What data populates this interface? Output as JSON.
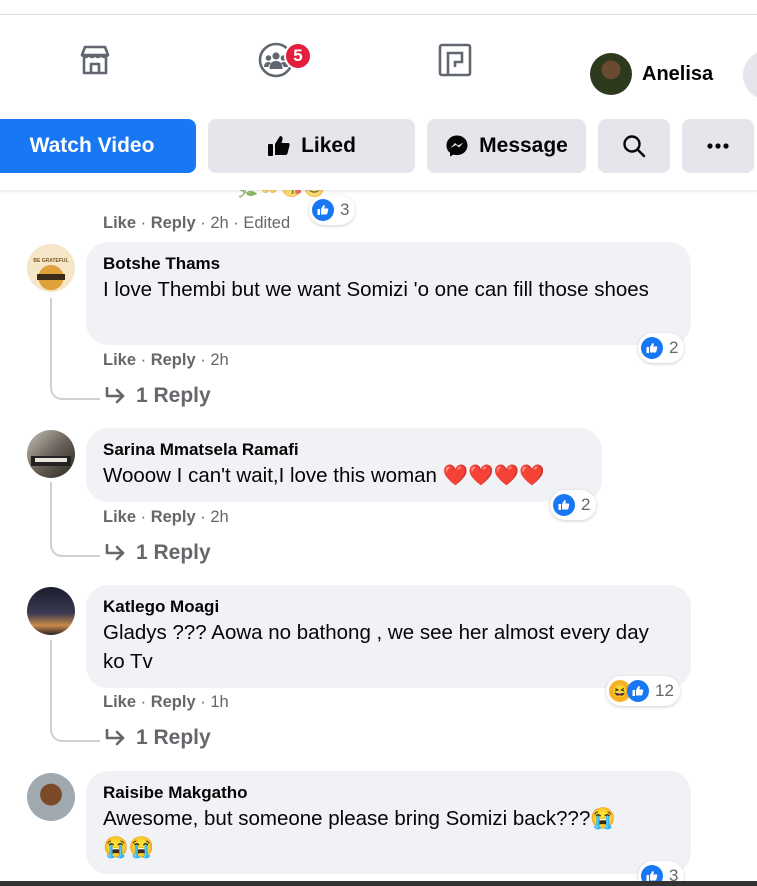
{
  "nav": {
    "icons": [
      "marketplace-icon",
      "groups-icon",
      "gaming-icon"
    ],
    "groups_badge": "5",
    "profile_name": "Anelisa"
  },
  "actions": {
    "watch": "Watch Video",
    "liked": "Liked",
    "message": "Message"
  },
  "partial_comment": {
    "like": "Like",
    "reply": "Reply",
    "time": "2h",
    "edited": "Edited",
    "reactions": "3"
  },
  "comments": [
    {
      "author": "Botshe Thams",
      "text": "I love Thembi but we want Somizi 'o one can fill those shoes",
      "like": "Like",
      "reply": "Reply",
      "time": "2h",
      "reactions": "2",
      "replies": "1 Reply"
    },
    {
      "author": "Sarina Mmatsela Ramafi",
      "text": "Wooow I can't wait,I love this woman",
      "hearts": "❤️❤️❤️❤️",
      "like": "Like",
      "reply": "Reply",
      "time": "2h",
      "reactions": "2",
      "replies": "1 Reply"
    },
    {
      "author": "Katlego Moagi",
      "text": "Gladys ??? Aowa no bathong , we see her almost every day ko Tv",
      "like": "Like",
      "reply": "Reply",
      "time": "1h",
      "reactions": "12",
      "replies": "1 Reply"
    },
    {
      "author": "Raisibe Makgatho",
      "text": "Awesome, but someone please bring Somizi back???",
      "emoji": "😭",
      "emoji_line2": "😭😭",
      "reactions": "3"
    }
  ],
  "colors": {
    "brand": "#1877f2",
    "badge": "#e41e3f",
    "bubble": "#f0f2f5",
    "secondary_text": "#65676b"
  }
}
